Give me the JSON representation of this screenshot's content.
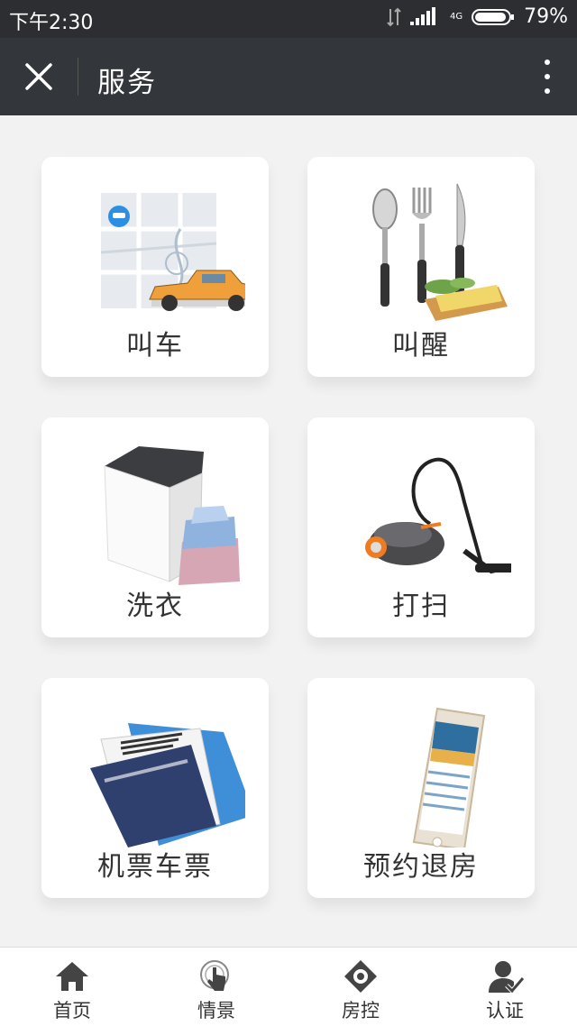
{
  "status": {
    "time": "下午2:30",
    "network": "4G",
    "battery": "79%"
  },
  "header": {
    "title": "服务"
  },
  "services": [
    {
      "label": "叫车",
      "icon": "taxi-map-icon"
    },
    {
      "label": "叫醒",
      "icon": "cutlery-icon"
    },
    {
      "label": "洗衣",
      "icon": "washing-machine-icon"
    },
    {
      "label": "打扫",
      "icon": "vacuum-cleaner-icon"
    },
    {
      "label": "机票车票",
      "icon": "passport-ticket-icon"
    },
    {
      "label": "预约退房",
      "icon": "smartphone-icon"
    }
  ],
  "tabs": [
    {
      "label": "首页",
      "icon": "home-icon"
    },
    {
      "label": "情景",
      "icon": "touch-icon"
    },
    {
      "label": "房控",
      "icon": "room-control-icon"
    },
    {
      "label": "认证",
      "icon": "verified-user-icon"
    }
  ]
}
